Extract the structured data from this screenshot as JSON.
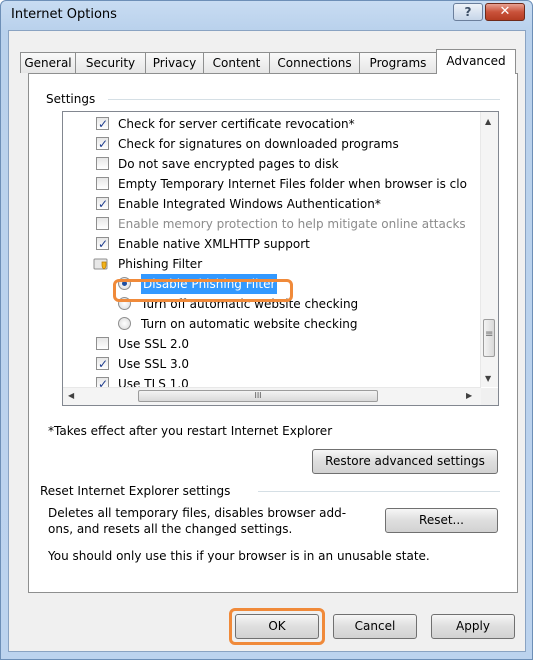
{
  "window": {
    "title": "Internet Options",
    "help_glyph": "?",
    "close_glyph": "✕"
  },
  "tabs": [
    "General",
    "Security",
    "Privacy",
    "Content",
    "Connections",
    "Programs",
    "Advanced"
  ],
  "active_tab": "Advanced",
  "settings": {
    "group_label": "Settings",
    "items": [
      {
        "type": "checkbox",
        "checked": true,
        "label": "Check for server certificate revocation*"
      },
      {
        "type": "checkbox",
        "checked": true,
        "label": "Check for signatures on downloaded programs"
      },
      {
        "type": "checkbox",
        "checked": false,
        "label": "Do not save encrypted pages to disk"
      },
      {
        "type": "checkbox",
        "checked": false,
        "label": "Empty Temporary Internet Files folder when browser is clo"
      },
      {
        "type": "checkbox",
        "checked": true,
        "label": "Enable Integrated Windows Authentication*"
      },
      {
        "type": "checkbox",
        "checked": false,
        "label": "Enable memory protection to help mitigate online attacks",
        "disabled": true
      },
      {
        "type": "checkbox",
        "checked": true,
        "label": "Enable native XMLHTTP support"
      },
      {
        "type": "folder",
        "label": "Phishing Filter"
      },
      {
        "type": "radio",
        "checked": true,
        "label": "Disable Phishing Filter",
        "selected": true
      },
      {
        "type": "radio",
        "checked": false,
        "label": "Turn off automatic website checking"
      },
      {
        "type": "radio",
        "checked": false,
        "label": "Turn on automatic website checking"
      },
      {
        "type": "checkbox",
        "checked": false,
        "label": "Use SSL 2.0"
      },
      {
        "type": "checkbox",
        "checked": true,
        "label": "Use SSL 3.0"
      },
      {
        "type": "checkbox",
        "checked": true,
        "label": "Use TLS 1.0"
      }
    ],
    "hscroll_thumb": "III",
    "footnote": "*Takes effect after you restart Internet Explorer",
    "restore_button": "Restore advanced settings"
  },
  "reset_group": {
    "label": "Reset Internet Explorer settings",
    "description": "Deletes all temporary files, disables browser add-ons, and resets all the changed settings.",
    "reset_button": "Reset...",
    "warning": "You should only use this if your browser is in an unusable state."
  },
  "footer": {
    "ok": "OK",
    "cancel": "Cancel",
    "apply": "Apply"
  },
  "highlight_color": "#f08a3a",
  "selection_color": "#3399ff"
}
